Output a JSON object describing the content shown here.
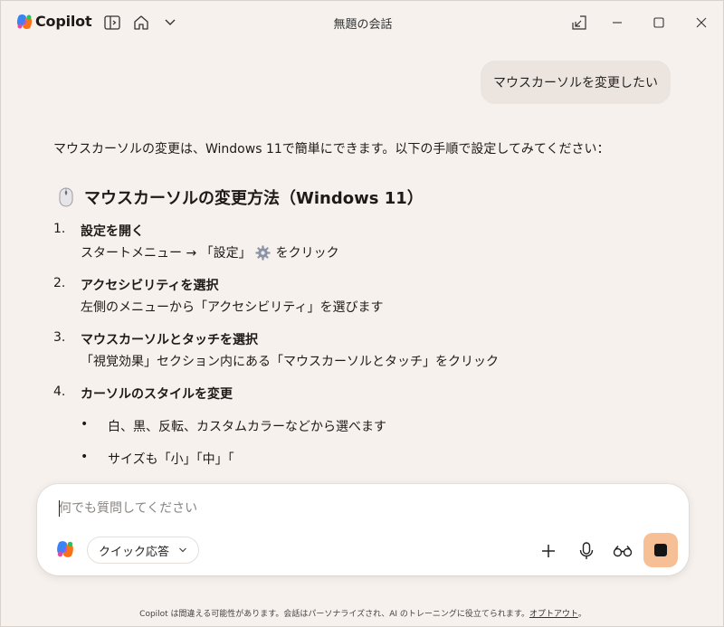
{
  "app": {
    "brand": "Copilot",
    "window_title": "無題の会話"
  },
  "conversation": {
    "user_message": "マウスカーソルを変更したい",
    "answer": {
      "intro": "マウスカーソルの変更は、Windows 11で簡単にできます。以下の手順で設定してみてください：",
      "heading": "マウスカーソルの変更方法（Windows 11）",
      "steps": [
        {
          "num": "1.",
          "title": "設定を開く",
          "desc_before": "スタートメニュー → 「設定」",
          "desc_after": "をクリック"
        },
        {
          "num": "2.",
          "title": "アクセシビリティを選択",
          "desc": "左側のメニューから「アクセシビリティ」を選びます"
        },
        {
          "num": "3.",
          "title": "マウスカーソルとタッチを選択",
          "desc": "「視覚効果」セクション内にある「マウスカーソルとタッチ」をクリック"
        },
        {
          "num": "4.",
          "title": "カーソルのスタイルを変更",
          "bullets": [
            "白、黒、反転、カスタムカラーなどから選べます",
            "サイズも「小」「中」「"
          ]
        }
      ]
    }
  },
  "composer": {
    "placeholder": "何でも質問してください",
    "mode_label": "クイック応答"
  },
  "footer": {
    "text": "Copilot は間違える可能性があります。会話はパーソナライズされ、AI のトレーニングに役立てられます。",
    "link": "オプトアウト",
    "end": "。"
  },
  "icons": {
    "sidebar": "sidebar-toggle-icon",
    "home": "home-icon",
    "dropdown": "chevron-down-icon",
    "popout": "popout-icon",
    "minimize": "minimize-icon",
    "maximize": "maximize-icon",
    "close": "close-icon",
    "plus": "plus-icon",
    "mic": "microphone-icon",
    "vision": "glasses-icon",
    "stop": "stop-icon"
  },
  "colors": {
    "background": "#f6f1ed",
    "user_bubble": "#ece4de",
    "send_button": "#f6bf95"
  }
}
